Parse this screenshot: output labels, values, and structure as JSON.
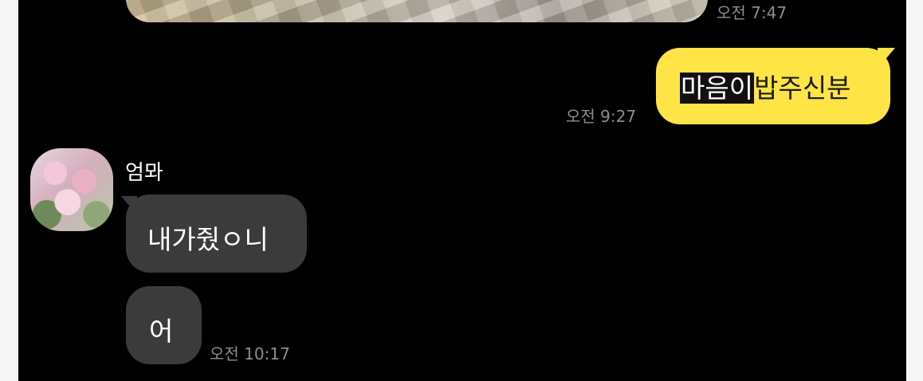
{
  "messages": {
    "photo": {
      "time": "오전 7:47"
    },
    "outgoing": {
      "text_highlighted": "마음이",
      "text_rest": "밥주신분",
      "time": "오전 9:27"
    },
    "incoming": {
      "sender": "엄뫄",
      "avatar_icon": "cherry-blossom-photo",
      "bubbles": [
        {
          "text": "내가줬ㅇ니"
        },
        {
          "text": "어"
        }
      ],
      "time": "오전 10:17"
    }
  },
  "colors": {
    "chat_background": "#000000",
    "outgoing_bubble": "#fee545",
    "incoming_bubble": "#3b3b3b",
    "timestamp": "#8e8e8e",
    "side_margin": "#f6f6f6"
  }
}
